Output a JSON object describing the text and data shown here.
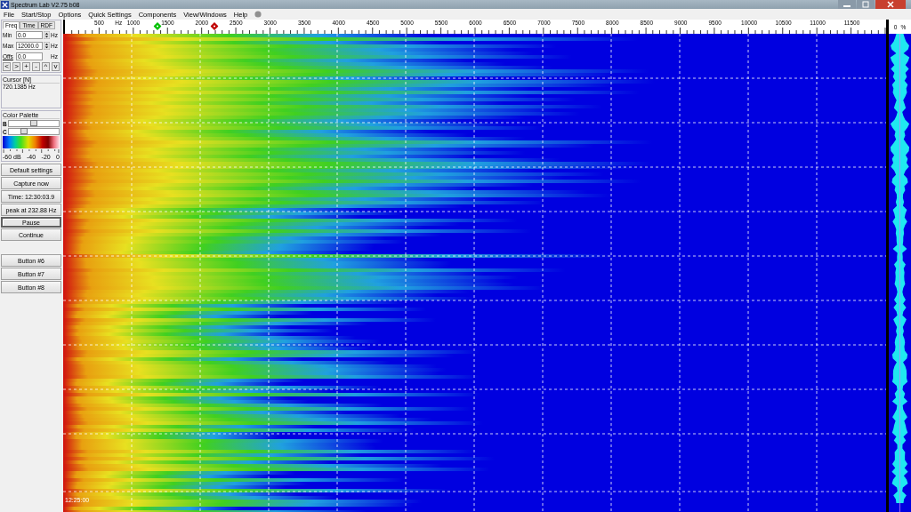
{
  "window": {
    "title": "Spectrum Lab V2.75 b08"
  },
  "menu": [
    {
      "label": "File"
    },
    {
      "label": "Start/Stop"
    },
    {
      "label": "Options"
    },
    {
      "label": "Quick Settings"
    },
    {
      "label": "Components"
    },
    {
      "label": "View/Windows"
    },
    {
      "label": "Help"
    }
  ],
  "tabs": [
    {
      "label": "Freq",
      "selected": true
    },
    {
      "label": "Time",
      "selected": false
    },
    {
      "label": "RDF",
      "selected": false
    }
  ],
  "fields": [
    {
      "label": "Min",
      "value": "0.0",
      "unit": "Hz",
      "kind": "spin"
    },
    {
      "label": "Max",
      "value": "12000.0",
      "unit": "Hz",
      "kind": "spin"
    },
    {
      "label": "Offs",
      "value": "0.0",
      "unit": "Hz",
      "kind": "plain"
    }
  ],
  "nav_buttons": [
    "<",
    ">",
    "+",
    "-",
    "^",
    "v"
  ],
  "cursor": {
    "title": "Cursor [N]",
    "value": "720.1385 Hz"
  },
  "color_palette": {
    "title": "Color Palette",
    "sliders": [
      {
        "label": "B",
        "level": 0.5
      },
      {
        "label": "C",
        "level": 0.28
      }
    ],
    "scale": [
      "-60 dB",
      "-40",
      "-20",
      "0"
    ]
  },
  "buttons": [
    {
      "label": "Default settings",
      "pressed": false
    },
    {
      "label": "Capture now",
      "pressed": false
    },
    {
      "label": "Time:  12:30:03.9",
      "pressed": false
    },
    {
      "label": "peak at 232.88 Hz",
      "pressed": false
    },
    {
      "label": "Pause",
      "pressed": true
    },
    {
      "label": "Continue",
      "pressed": false
    },
    {
      "label": "Button #6",
      "pressed": false
    },
    {
      "label": "Button #7",
      "pressed": false
    },
    {
      "label": "Button #8",
      "pressed": false
    }
  ],
  "frequency_axis": {
    "unit": "Hz",
    "labels": [
      "500",
      "1000",
      "1500",
      "2000",
      "2500",
      "3000",
      "3500",
      "4000",
      "4500",
      "5000",
      "5500",
      "6000",
      "6500",
      "7000",
      "7500",
      "8000",
      "8500",
      "9000",
      "9500",
      "10000",
      "10500",
      "11000",
      "11500"
    ],
    "markers": [
      {
        "color": "#00c000"
      },
      {
        "color": "#c00000"
      }
    ]
  },
  "spectrogram": {
    "time_label": "12:25:00"
  },
  "level_column": {
    "labels": [
      "0",
      "%"
    ]
  }
}
